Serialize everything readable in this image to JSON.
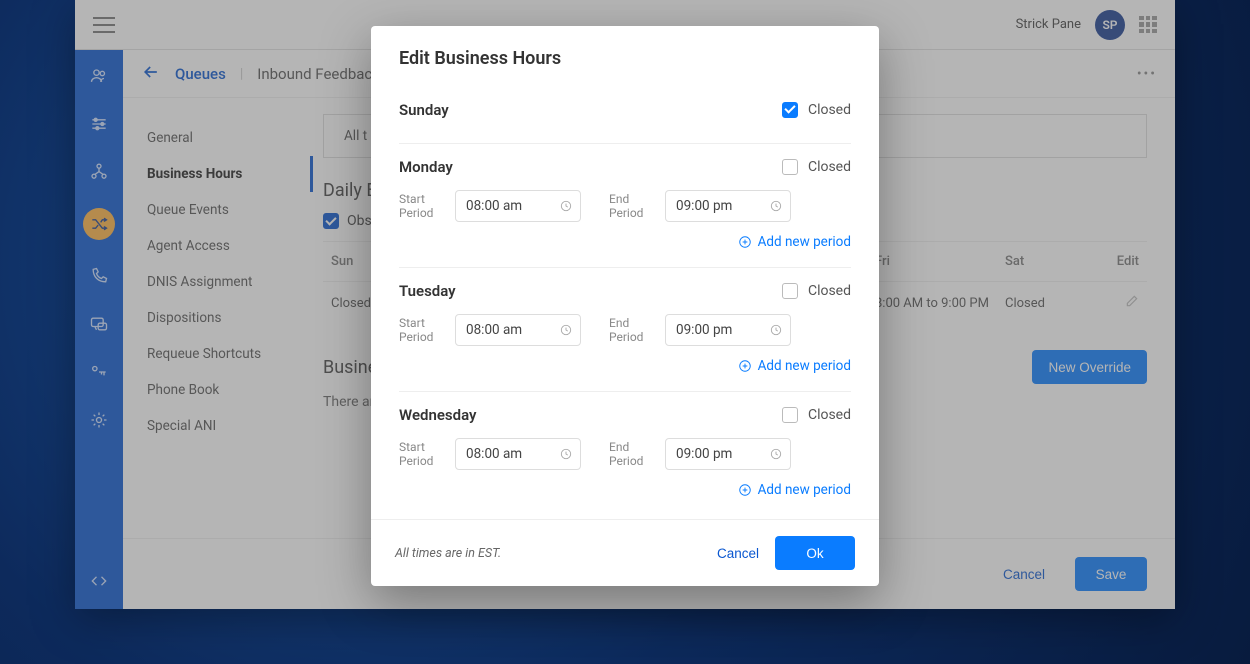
{
  "topbar": {
    "user_name": "Strick Pane",
    "avatar_initials": "SP"
  },
  "breadcrumb": {
    "parent": "Queues",
    "current": "Inbound Feedback Calls"
  },
  "sidenav": {
    "items": [
      {
        "label": "General"
      },
      {
        "label": "Business Hours",
        "active": true
      },
      {
        "label": "Queue Events"
      },
      {
        "label": "Agent Access"
      },
      {
        "label": "DNIS Assignment"
      },
      {
        "label": "Dispositions"
      },
      {
        "label": "Requeue Shortcuts"
      },
      {
        "label": "Phone Book"
      },
      {
        "label": "Special ANI"
      }
    ]
  },
  "detail": {
    "tab_label": "All t",
    "daily_title": "Daily B",
    "observe_label": "Obs",
    "week_headers": {
      "sun": "Sun",
      "fri": "Fri",
      "sat": "Sat",
      "edit": "Edit"
    },
    "week_row": {
      "sun": "Closed",
      "fri": "8:00 AM to 9:00 PM",
      "sat": "Closed"
    },
    "override_title": "Busine",
    "override_empty": "There ar",
    "new_override_btn": "New Override",
    "footer_cancel": "Cancel",
    "footer_save": "Save"
  },
  "modal": {
    "title": "Edit Business Hours",
    "closed_label": "Closed",
    "start_label": "Start Period",
    "end_label": "End Period",
    "add_period": "Add new period",
    "tz_note": "All times are in EST.",
    "cancel": "Cancel",
    "ok": "Ok",
    "days": [
      {
        "name": "Sunday",
        "closed": true
      },
      {
        "name": "Monday",
        "closed": false,
        "start": "08:00 am",
        "end": "09:00 pm"
      },
      {
        "name": "Tuesday",
        "closed": false,
        "start": "08:00 am",
        "end": "09:00 pm"
      },
      {
        "name": "Wednesday",
        "closed": false,
        "start": "08:00 am",
        "end": "09:00 pm"
      }
    ]
  }
}
